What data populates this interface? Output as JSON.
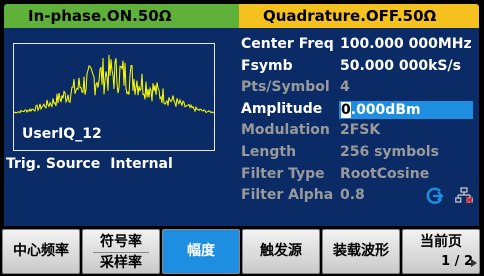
{
  "tabs": {
    "ch1": "In-phase.ON.50Ω",
    "ch2": "Quadrature.OFF.50Ω"
  },
  "waveform": {
    "name": "UserIQ_12"
  },
  "trigger": {
    "label": "Trig. Source",
    "value": "Internal"
  },
  "params": [
    {
      "label": "Center Freq",
      "value": "100.000 000MHz",
      "state": "on"
    },
    {
      "label": "Fsymb",
      "value": "50.000 000kS/s",
      "state": "on"
    },
    {
      "label": "Pts/Symbol",
      "value": "4",
      "state": "off"
    },
    {
      "label": "Amplitude",
      "value": "0.000dBm",
      "state": "on",
      "active": true
    },
    {
      "label": "Modulation",
      "value": "2FSK",
      "state": "off"
    },
    {
      "label": "Length",
      "value": "256 symbols",
      "state": "off"
    },
    {
      "label": "Filter Type",
      "value": "RootCosine",
      "state": "off"
    },
    {
      "label": "Filter Alpha",
      "value": "0.8",
      "state": "off"
    }
  ],
  "amplitude": {
    "cursor_char": "0",
    "rest": ".000dBm"
  },
  "softkeys": {
    "k1": "中心频率",
    "k2_top": "符号率",
    "k2_bottom": "采样率",
    "k3": "幅度",
    "k4": "触发源",
    "k5": "装载波形",
    "k6_top": "当前页",
    "k6_bottom": "1 / 2"
  },
  "colors": {
    "ch1_tab": "#5fb13a",
    "ch2_tab": "#f4c11f",
    "panel": "#0b2b66",
    "waveform": "#ffff00",
    "highlight": "#1e8fe0"
  },
  "icons": {
    "return": "return-arrow-icon",
    "network": "network-icon"
  }
}
